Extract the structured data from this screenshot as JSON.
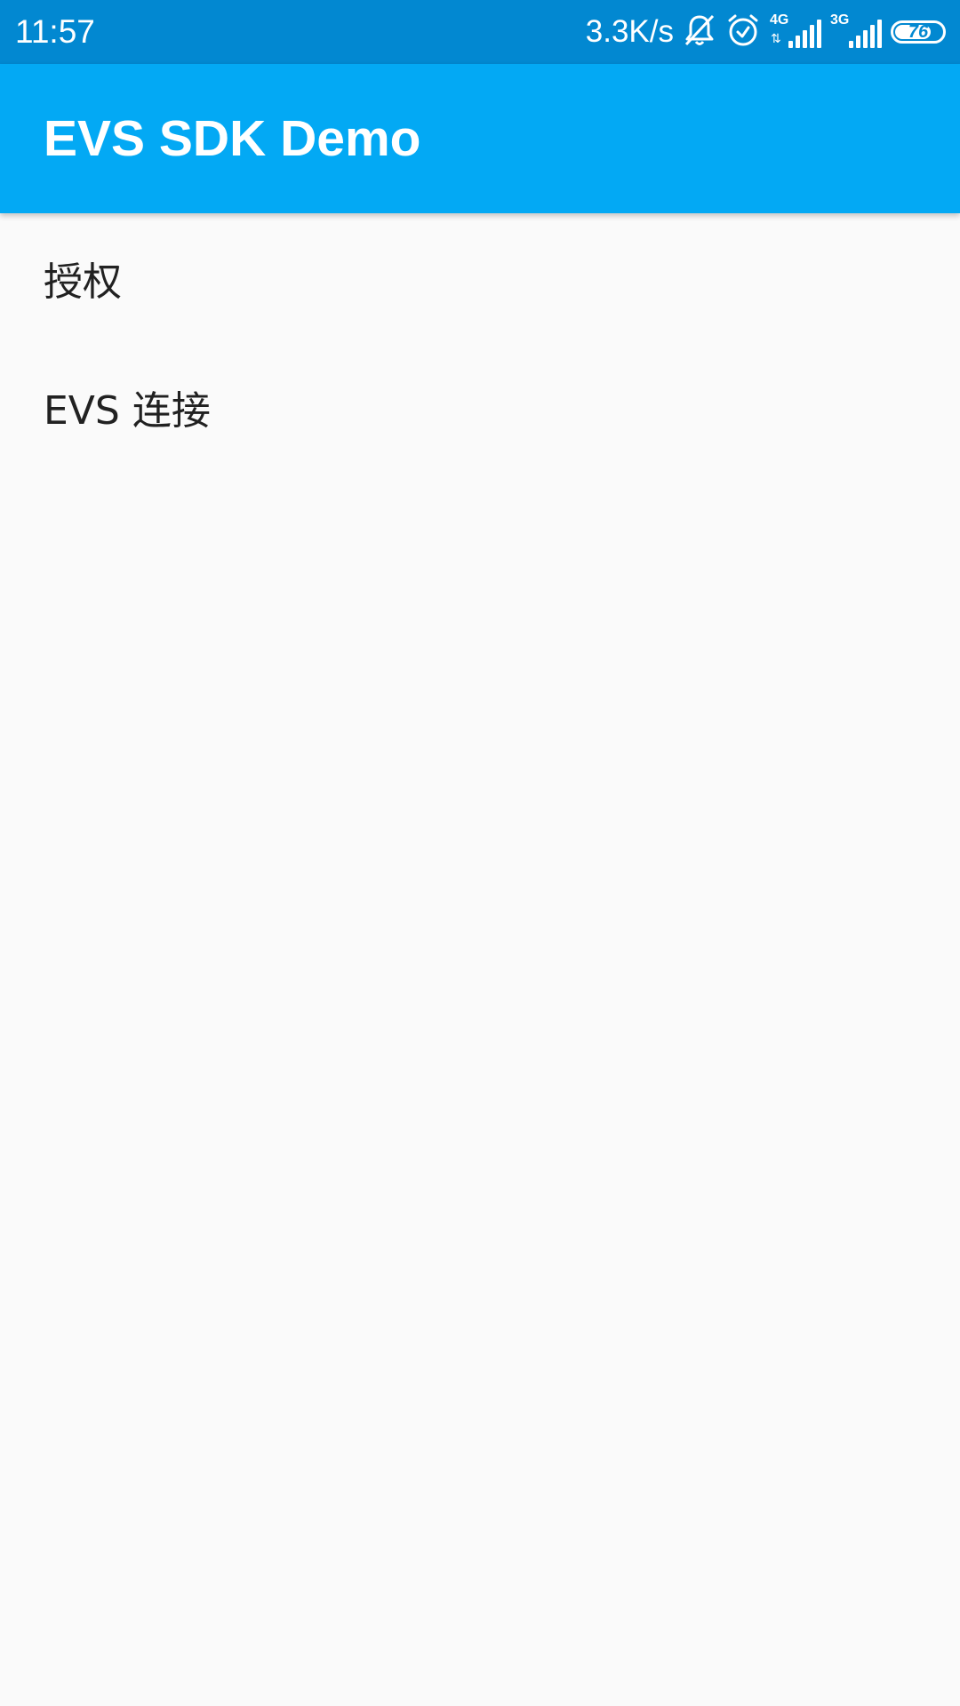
{
  "status_bar": {
    "time": "11:57",
    "net_speed": "3.3K/s",
    "icons": [
      "bell-off-icon",
      "alarm-icon",
      "signal-4g-icon",
      "signal-3g-icon",
      "battery-icon"
    ],
    "signal_1": {
      "tech": "4G",
      "arrows": "⇅"
    },
    "signal_2": {
      "tech": "3G"
    },
    "battery_level": "76",
    "battery_fraction": 0.76
  },
  "app_bar": {
    "title": "EVS SDK Demo",
    "color": "#03a9f4"
  },
  "list": {
    "items": [
      {
        "label": "授权"
      },
      {
        "label": "EVS 连接"
      }
    ]
  },
  "colors": {
    "status_bar": "#0288d1",
    "app_bar": "#03a9f4",
    "background": "#fafafa",
    "text": "#212121"
  }
}
